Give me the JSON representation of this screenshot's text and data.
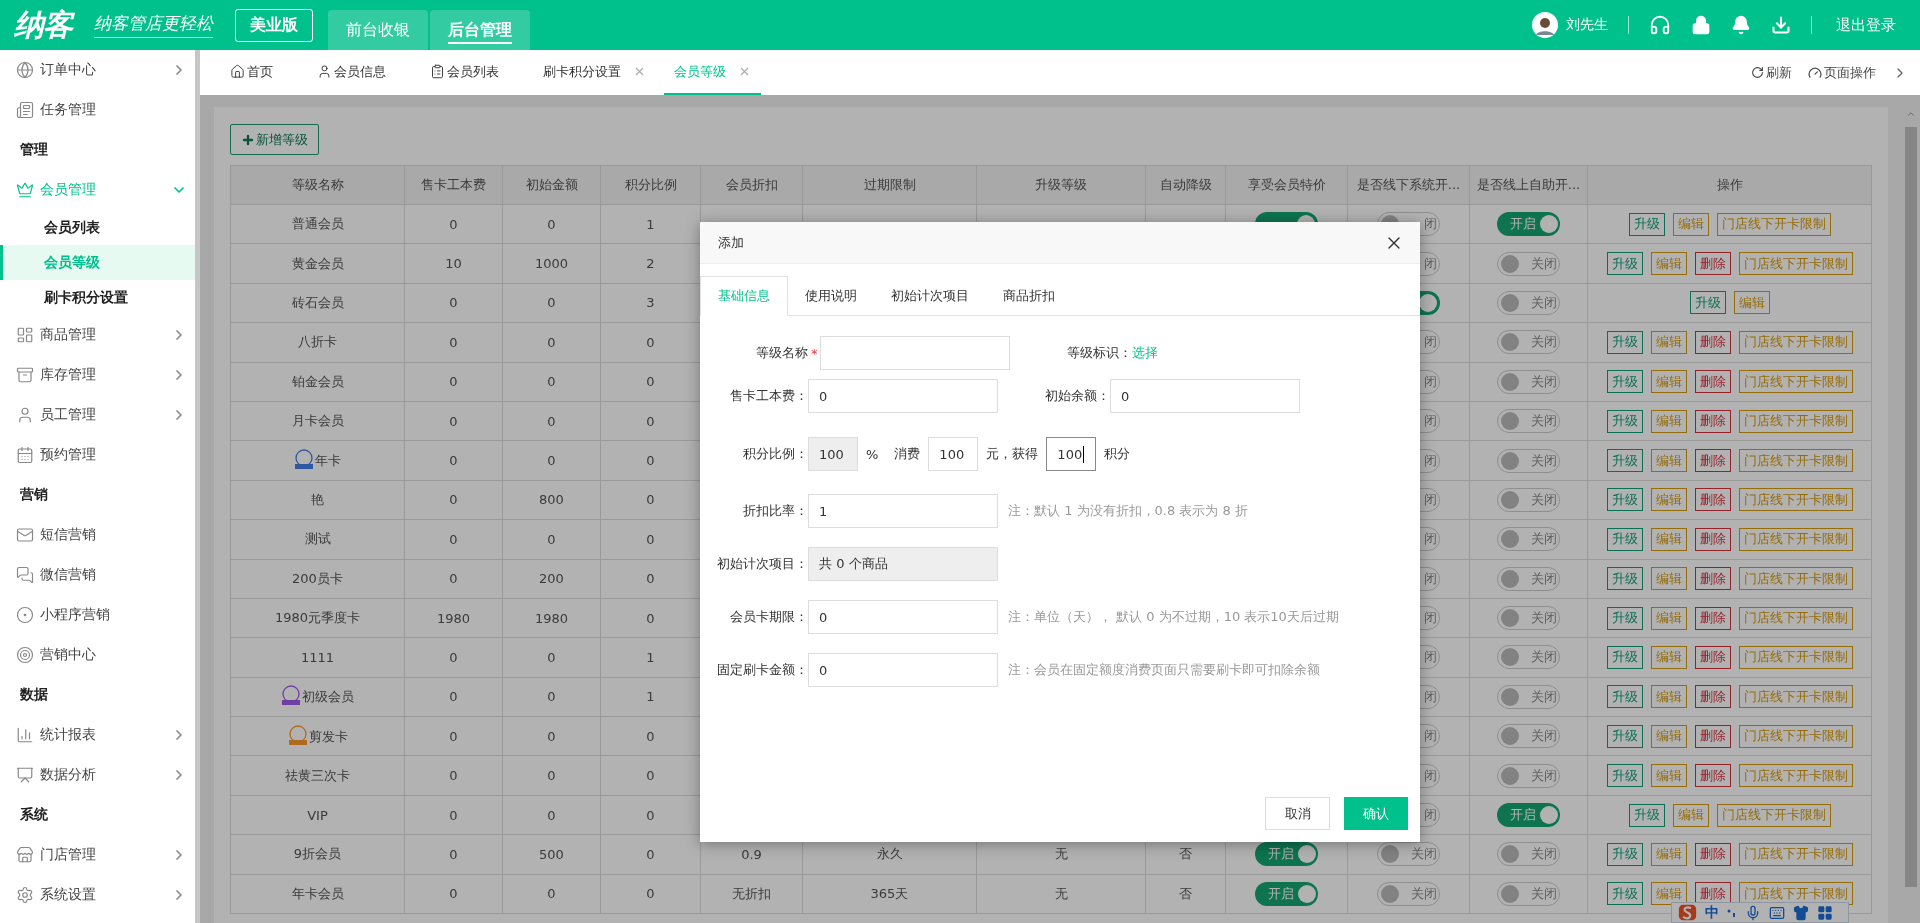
{
  "header": {
    "logo": "纳客",
    "slogan": "纳客管店更轻松",
    "edition": "美业版",
    "nav": [
      {
        "label": "前台收银",
        "selected": false
      },
      {
        "label": "后台管理",
        "selected": true
      }
    ],
    "user": "刘先生",
    "logout": "退出登录"
  },
  "sidebar": {
    "items": [
      {
        "kind": "item",
        "label": "订单中心",
        "has_children": true,
        "expanded": false,
        "selected": false
      },
      {
        "kind": "item",
        "label": "任务管理",
        "has_children": false,
        "expanded": false,
        "selected": false
      },
      {
        "kind": "section",
        "label": "管理"
      },
      {
        "kind": "item",
        "label": "会员管理",
        "has_children": true,
        "expanded": true,
        "selected": true
      },
      {
        "kind": "subitem",
        "label": "会员列表",
        "selected": false
      },
      {
        "kind": "subitem",
        "label": "会员等级",
        "selected": true
      },
      {
        "kind": "subitem",
        "label": "刷卡积分设置",
        "selected": false
      },
      {
        "kind": "item",
        "label": "商品管理",
        "has_children": true,
        "expanded": false,
        "selected": false
      },
      {
        "kind": "item",
        "label": "库存管理",
        "has_children": true,
        "expanded": false,
        "selected": false
      },
      {
        "kind": "item",
        "label": "员工管理",
        "has_children": true,
        "expanded": false,
        "selected": false
      },
      {
        "kind": "item",
        "label": "预约管理",
        "has_children": false,
        "expanded": false,
        "selected": false
      },
      {
        "kind": "section",
        "label": "营销"
      },
      {
        "kind": "item",
        "label": "短信营销",
        "has_children": false,
        "expanded": false,
        "selected": false
      },
      {
        "kind": "item",
        "label": "微信营销",
        "has_children": false,
        "expanded": false,
        "selected": false
      },
      {
        "kind": "item",
        "label": "小程序营销",
        "has_children": false,
        "expanded": false,
        "selected": false
      },
      {
        "kind": "item",
        "label": "营销中心",
        "has_children": false,
        "expanded": false,
        "selected": false
      },
      {
        "kind": "section",
        "label": "数据"
      },
      {
        "kind": "item",
        "label": "统计报表",
        "has_children": true,
        "expanded": false,
        "selected": false
      },
      {
        "kind": "item",
        "label": "数据分析",
        "has_children": true,
        "expanded": false,
        "selected": false
      },
      {
        "kind": "section",
        "label": "系统"
      },
      {
        "kind": "item",
        "label": "门店管理",
        "has_children": true,
        "expanded": false,
        "selected": false
      },
      {
        "kind": "item",
        "label": "系统设置",
        "has_children": true,
        "expanded": false,
        "selected": false
      }
    ]
  },
  "page_tabs": {
    "tabs": [
      {
        "label": "首页",
        "closable": false,
        "selected": false
      },
      {
        "label": "会员信息",
        "closable": false,
        "selected": false
      },
      {
        "label": "会员列表",
        "closable": false,
        "selected": false
      },
      {
        "label": "刷卡积分设置",
        "closable": true,
        "selected": false
      },
      {
        "label": "会员等级",
        "closable": true,
        "selected": true
      }
    ],
    "refresh": "刷新",
    "page_actions": "页面操作"
  },
  "add_button": "新增等级",
  "table": {
    "columns": [
      "等级名称",
      "售卡工本费",
      "初始金额",
      "积分比例",
      "会员折扣",
      "过期限制",
      "升级等级",
      "自动降级",
      "享受会员特价",
      "是否线下系统开...",
      "是否线上自助开...",
      "操作"
    ],
    "rows": [
      {
        "name": "普通会员",
        "card_fee": "0",
        "initial_amount": "0",
        "points_ratio": "1",
        "member_price": {
          "on": true
        },
        "offline_open": {
          "on": false,
          "label": "闭"
        },
        "online_open": {
          "on": true,
          "label": "开启"
        },
        "actions": [
          {
            "kind": "upgrade",
            "label": "升级"
          },
          {
            "kind": "edit",
            "label": "编辑"
          },
          {
            "kind": "limit",
            "label": "门店线下开卡限制"
          }
        ]
      },
      {
        "name": "黄金会员",
        "card_fee": "10",
        "initial_amount": "1000",
        "points_ratio": "2",
        "offline_open": {
          "on": false,
          "label": "闭"
        },
        "online_open": {
          "on": false,
          "label": "关闭"
        },
        "actions": [
          {
            "kind": "upgrade",
            "label": "升级"
          },
          {
            "kind": "edit",
            "label": "编辑"
          },
          {
            "kind": "delete",
            "label": "删除"
          },
          {
            "kind": "limit",
            "label": "门店线下开卡限制"
          }
        ]
      },
      {
        "name": "砖石会员",
        "card_fee": "0",
        "initial_amount": "0",
        "points_ratio": "3",
        "offline_open": {
          "on": true
        },
        "online_open": {
          "on": false,
          "label": "关闭"
        },
        "actions": [
          {
            "kind": "upgrade",
            "label": "升级"
          },
          {
            "kind": "edit",
            "label": "编辑"
          }
        ]
      },
      {
        "name": "八折卡",
        "card_fee": "0",
        "initial_amount": "0",
        "points_ratio": "0",
        "offline_open": {
          "on": false,
          "label": "闭"
        },
        "online_open": {
          "on": false,
          "label": "关闭"
        },
        "actions": [
          {
            "kind": "upgrade",
            "label": "升级"
          },
          {
            "kind": "edit",
            "label": "编辑"
          },
          {
            "kind": "delete",
            "label": "删除"
          },
          {
            "kind": "limit",
            "label": "门店线下开卡限制"
          }
        ]
      },
      {
        "name": "铂金会员",
        "card_fee": "0",
        "initial_amount": "0",
        "points_ratio": "0",
        "offline_open": {
          "on": false,
          "label": "闭"
        },
        "online_open": {
          "on": false,
          "label": "关闭"
        },
        "actions": [
          {
            "kind": "upgrade",
            "label": "升级"
          },
          {
            "kind": "edit",
            "label": "编辑"
          },
          {
            "kind": "delete",
            "label": "删除"
          },
          {
            "kind": "limit",
            "label": "门店线下开卡限制"
          }
        ]
      },
      {
        "name": "月卡会员",
        "card_fee": "0",
        "initial_amount": "0",
        "points_ratio": "0",
        "offline_open": {
          "on": false,
          "label": "闭"
        },
        "online_open": {
          "on": false,
          "label": "关闭"
        },
        "actions": [
          {
            "kind": "upgrade",
            "label": "升级"
          },
          {
            "kind": "edit",
            "label": "编辑"
          },
          {
            "kind": "delete",
            "label": "删除"
          },
          {
            "kind": "limit",
            "label": "门店线下开卡限制"
          }
        ]
      },
      {
        "name": "年卡",
        "color": "#2f58a0",
        "card_fee": "0",
        "initial_amount": "0",
        "points_ratio": "0",
        "offline_open": {
          "on": false,
          "label": "闭"
        },
        "online_open": {
          "on": false,
          "label": "关闭"
        },
        "actions": [
          {
            "kind": "upgrade",
            "label": "升级"
          },
          {
            "kind": "edit",
            "label": "编辑"
          },
          {
            "kind": "delete",
            "label": "删除"
          },
          {
            "kind": "limit",
            "label": "门店线下开卡限制"
          }
        ]
      },
      {
        "name": "艳",
        "card_fee": "0",
        "initial_amount": "800",
        "points_ratio": "0",
        "offline_open": {
          "on": false,
          "label": "闭"
        },
        "online_open": {
          "on": false,
          "label": "关闭"
        },
        "actions": [
          {
            "kind": "upgrade",
            "label": "升级"
          },
          {
            "kind": "edit",
            "label": "编辑"
          },
          {
            "kind": "delete",
            "label": "删除"
          },
          {
            "kind": "limit",
            "label": "门店线下开卡限制"
          }
        ]
      },
      {
        "name": "测试",
        "card_fee": "0",
        "initial_amount": "0",
        "points_ratio": "0",
        "offline_open": {
          "on": false,
          "label": "闭"
        },
        "online_open": {
          "on": false,
          "label": "关闭"
        },
        "actions": [
          {
            "kind": "upgrade",
            "label": "升级"
          },
          {
            "kind": "edit",
            "label": "编辑"
          },
          {
            "kind": "delete",
            "label": "删除"
          },
          {
            "kind": "limit",
            "label": "门店线下开卡限制"
          }
        ]
      },
      {
        "name": "200员卡",
        "card_fee": "0",
        "initial_amount": "200",
        "points_ratio": "0",
        "offline_open": {
          "on": false,
          "label": "闭"
        },
        "online_open": {
          "on": false,
          "label": "关闭"
        },
        "actions": [
          {
            "kind": "upgrade",
            "label": "升级"
          },
          {
            "kind": "edit",
            "label": "编辑"
          },
          {
            "kind": "delete",
            "label": "删除"
          },
          {
            "kind": "limit",
            "label": "门店线下开卡限制"
          }
        ]
      },
      {
        "name": "1980元季度卡",
        "card_fee": "1980",
        "initial_amount": "1980",
        "points_ratio": "0",
        "offline_open": {
          "on": false,
          "label": "闭"
        },
        "online_open": {
          "on": false,
          "label": "关闭"
        },
        "actions": [
          {
            "kind": "upgrade",
            "label": "升级"
          },
          {
            "kind": "edit",
            "label": "编辑"
          },
          {
            "kind": "delete",
            "label": "删除"
          },
          {
            "kind": "limit",
            "label": "门店线下开卡限制"
          }
        ]
      },
      {
        "name": "1111",
        "card_fee": "0",
        "initial_amount": "0",
        "points_ratio": "1",
        "offline_open": {
          "on": false,
          "label": "闭"
        },
        "online_open": {
          "on": false,
          "label": "关闭"
        },
        "actions": [
          {
            "kind": "upgrade",
            "label": "升级"
          },
          {
            "kind": "edit",
            "label": "编辑"
          },
          {
            "kind": "delete",
            "label": "删除"
          },
          {
            "kind": "limit",
            "label": "门店线下开卡限制"
          }
        ]
      },
      {
        "name": "初级会员",
        "color": "#7040a0",
        "card_fee": "0",
        "initial_amount": "0",
        "points_ratio": "1",
        "offline_open": {
          "on": false,
          "label": "闭"
        },
        "online_open": {
          "on": false,
          "label": "关闭"
        },
        "actions": [
          {
            "kind": "upgrade",
            "label": "升级"
          },
          {
            "kind": "edit",
            "label": "编辑"
          },
          {
            "kind": "delete",
            "label": "删除"
          },
          {
            "kind": "limit",
            "label": "门店线下开卡限制"
          }
        ]
      },
      {
        "name": "剪发卡",
        "color": "#b06a20",
        "card_fee": "0",
        "initial_amount": "0",
        "points_ratio": "0",
        "offline_open": {
          "on": false,
          "label": "闭"
        },
        "online_open": {
          "on": false,
          "label": "关闭"
        },
        "actions": [
          {
            "kind": "upgrade",
            "label": "升级"
          },
          {
            "kind": "edit",
            "label": "编辑"
          },
          {
            "kind": "delete",
            "label": "删除"
          },
          {
            "kind": "limit",
            "label": "门店线下开卡限制"
          }
        ]
      },
      {
        "name": "祛黄三次卡",
        "card_fee": "0",
        "initial_amount": "0",
        "points_ratio": "0",
        "offline_open": {
          "on": false,
          "label": "闭"
        },
        "online_open": {
          "on": false,
          "label": "关闭"
        },
        "actions": [
          {
            "kind": "upgrade",
            "label": "升级"
          },
          {
            "kind": "edit",
            "label": "编辑"
          },
          {
            "kind": "delete",
            "label": "删除"
          },
          {
            "kind": "limit",
            "label": "门店线下开卡限制"
          }
        ]
      },
      {
        "name": "VIP",
        "card_fee": "0",
        "initial_amount": "0",
        "points_ratio": "0",
        "offline_open": {
          "on": false,
          "label": "闭"
        },
        "online_open": {
          "on": true,
          "label": "开启"
        },
        "actions": [
          {
            "kind": "upgrade",
            "label": "升级"
          },
          {
            "kind": "edit",
            "label": "编辑"
          },
          {
            "kind": "limit",
            "label": "门店线下开卡限制"
          }
        ]
      },
      {
        "name": "9折会员",
        "card_fee": "0",
        "initial_amount": "500",
        "points_ratio": "0",
        "discount": "0.9",
        "expiry": "永久",
        "upgrade_level": "无",
        "auto_downgrade": "否",
        "member_price": {
          "on": true,
          "label": "开启"
        },
        "offline_open": {
          "on": false,
          "label": "关闭"
        },
        "online_open": {
          "on": false,
          "label": "关闭"
        },
        "actions": [
          {
            "kind": "upgrade",
            "label": "升级"
          },
          {
            "kind": "edit",
            "label": "编辑"
          },
          {
            "kind": "delete",
            "label": "删除"
          },
          {
            "kind": "limit",
            "label": "门店线下开卡限制"
          }
        ]
      },
      {
        "name": "年卡会员",
        "card_fee": "0",
        "initial_amount": "0",
        "points_ratio": "0",
        "discount": "无折扣",
        "expiry": "365天",
        "upgrade_level": "无",
        "auto_downgrade": "否",
        "member_price": {
          "on": true,
          "label": "开启"
        },
        "offline_open": {
          "on": false,
          "label": "关闭"
        },
        "online_open": {
          "on": false,
          "label": "关闭"
        },
        "actions": [
          {
            "kind": "upgrade",
            "label": "升级"
          },
          {
            "kind": "edit",
            "label": "编辑"
          },
          {
            "kind": "delete",
            "label": "删除"
          },
          {
            "kind": "limit",
            "label": "门店线下开卡限制"
          }
        ]
      }
    ]
  },
  "dialog": {
    "title": "添加",
    "tabs": [
      {
        "label": "基础信息",
        "selected": true
      },
      {
        "label": "使用说明",
        "selected": false
      },
      {
        "label": "初始计次项目",
        "selected": false
      },
      {
        "label": "商品折扣",
        "selected": false
      }
    ],
    "level_name": {
      "label": "等级名称",
      "required_mark": "*"
    },
    "level_badge": {
      "label": "等级标识：",
      "link": "选择"
    },
    "card_fee": {
      "label": "售卡工本费：",
      "value": "0"
    },
    "initial_balance": {
      "label": "初始余额：",
      "value": "0"
    },
    "points": {
      "label": "积分比例：",
      "percent": {
        "value": "100",
        "disabled": true
      },
      "percent_unit": "%",
      "spend_label": "消费",
      "spend": {
        "value": "100",
        "focused": false
      },
      "spend_unit": "元，获得",
      "earn": {
        "value": "100",
        "focused": true
      },
      "earn_unit": "积分"
    },
    "discount_rate": {
      "label": "折扣比率：",
      "value": "1",
      "note": "注：默认 1 为没有折扣，0.8 表示为 8 折"
    },
    "initial_items": {
      "label": "初始计次项目：",
      "value": "共 0 个商品",
      "disabled": true
    },
    "card_period": {
      "label": "会员卡期限：",
      "value": "0",
      "note": "注：单位（天）， 默认 0 为不过期，10 表示10天后过期"
    },
    "fixed_amount": {
      "label": "固定刷卡金额：",
      "value": "0",
      "note": "注：会员在固定额度消费页面只需要刷卡即可扣除余额"
    },
    "buttons": [
      {
        "kind": "cancel",
        "label": "取消"
      },
      {
        "kind": "confirm",
        "label": "确认"
      }
    ]
  },
  "ime_bar": {
    "mode": "中"
  }
}
